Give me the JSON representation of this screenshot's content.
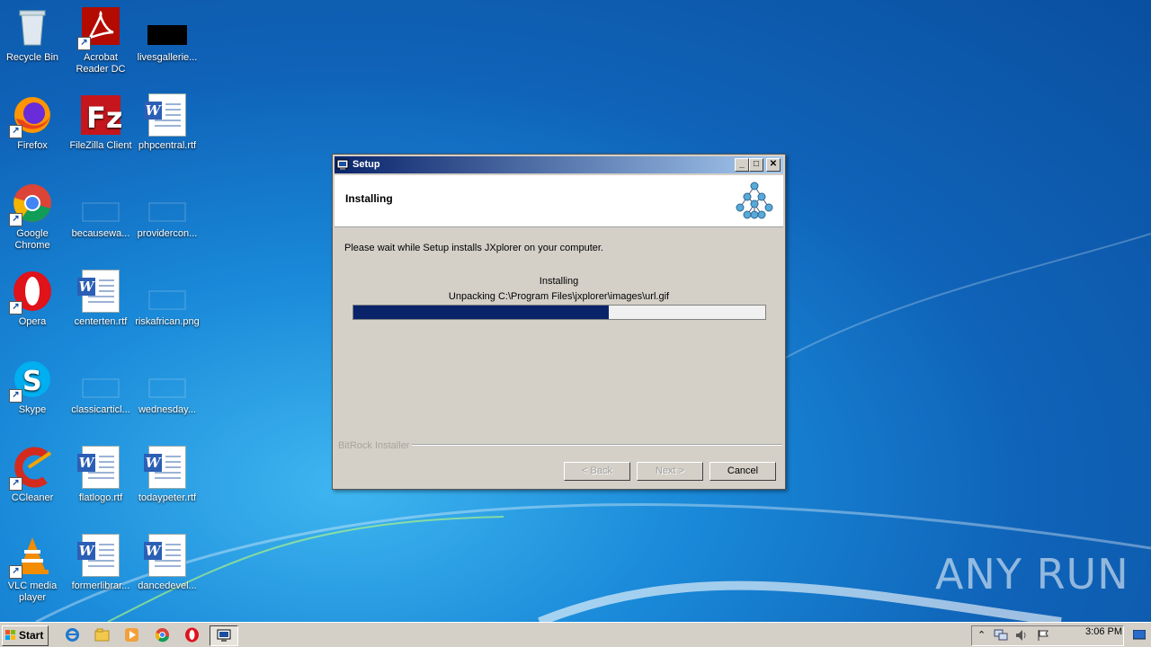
{
  "desktop": {
    "icons": [
      {
        "label": "Recycle Bin"
      },
      {
        "label": "Acrobat Reader DC"
      },
      {
        "label": "livesgallerie..."
      },
      {
        "label": "Firefox"
      },
      {
        "label": "FileZilla Client"
      },
      {
        "label": "phpcentral.rtf"
      },
      {
        "label": "Google Chrome"
      },
      {
        "label": "becausewa..."
      },
      {
        "label": "providercon..."
      },
      {
        "label": "Opera"
      },
      {
        "label": "centerten.rtf"
      },
      {
        "label": "riskafrican.png"
      },
      {
        "label": "Skype"
      },
      {
        "label": "classicarticl..."
      },
      {
        "label": "wednesday..."
      },
      {
        "label": "CCleaner"
      },
      {
        "label": "flatlogo.rtf"
      },
      {
        "label": "todaypeter.rtf"
      },
      {
        "label": "VLC media player"
      },
      {
        "label": "formerlibrar..."
      },
      {
        "label": "dancedevel..."
      }
    ]
  },
  "dialog": {
    "title": "Setup",
    "header_title": "Installing",
    "message": "Please wait while Setup installs JXplorer on your computer.",
    "status": "Installing",
    "detail": "Unpacking C:\\Program Files\\jxplorer\\images\\url.gif",
    "progress_fraction": 0.62,
    "brand": "BitRock Installer",
    "buttons": {
      "back": "< Back",
      "next": "Next >",
      "cancel": "Cancel"
    }
  },
  "taskbar": {
    "start_label": "Start",
    "clock": "3:06 PM"
  },
  "watermark": "ANY RUN",
  "colors": {
    "titlebar": "#0a246a",
    "progress": "#0a246a",
    "desktop": "#1a8ad9"
  }
}
